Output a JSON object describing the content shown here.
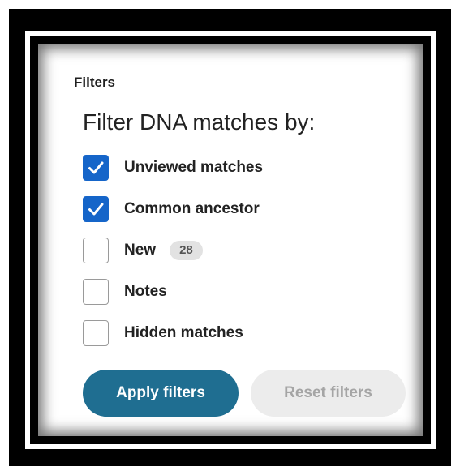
{
  "panel": {
    "heading": "Filters",
    "title": "Filter DNA matches by:"
  },
  "filters": [
    {
      "label": "Unviewed matches",
      "checked": true
    },
    {
      "label": "Common ancestor",
      "checked": true
    },
    {
      "label": "New",
      "checked": false,
      "badge": "28"
    },
    {
      "label": "Notes",
      "checked": false
    },
    {
      "label": "Hidden matches",
      "checked": false
    }
  ],
  "buttons": {
    "apply_label": "Apply filters",
    "reset_label": "Reset filters"
  },
  "colors": {
    "checkbox_checked": "#1565c9",
    "apply_button": "#1f6e91",
    "reset_button_bg": "#ececec",
    "reset_button_text": "#a5a5a5",
    "badge_bg": "#e2e2e2"
  },
  "icons": {
    "checkmark": "check-icon"
  }
}
